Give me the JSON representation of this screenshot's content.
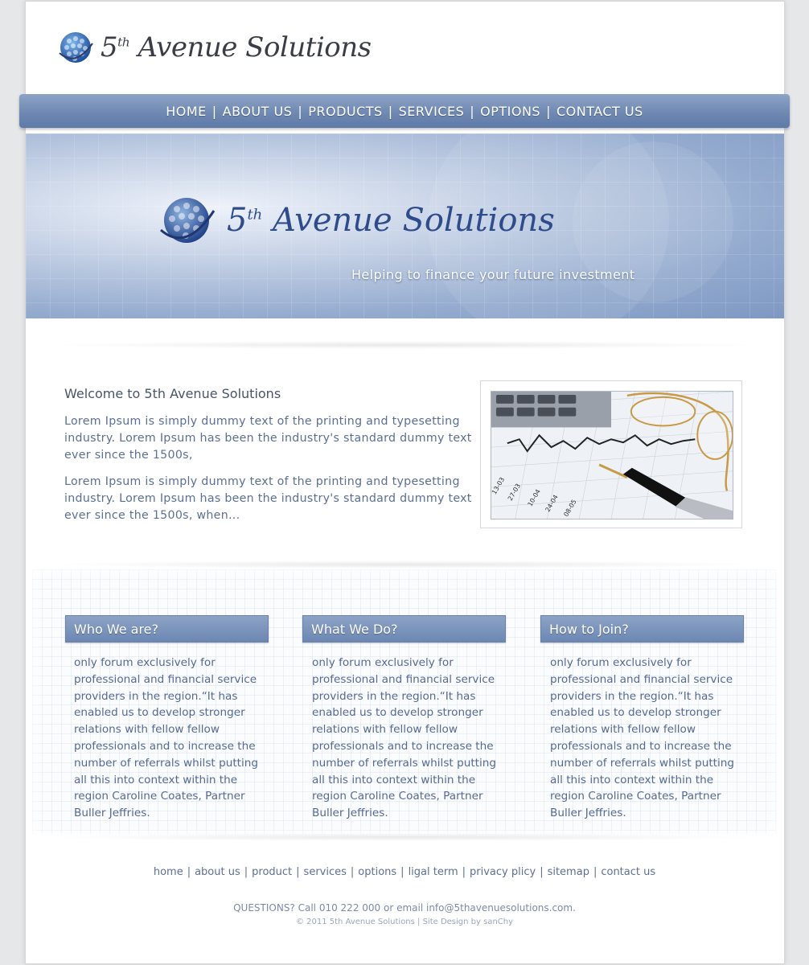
{
  "brand": {
    "name_main": "5",
    "name_sup": "th",
    "name_rest": "Avenue Solutions"
  },
  "nav": {
    "items": [
      {
        "label": "HOME"
      },
      {
        "label": "ABOUT US"
      },
      {
        "label": "PRODUCTS"
      },
      {
        "label": "SERVICES"
      },
      {
        "label": "OPTIONS"
      },
      {
        "label": "CONTACT US"
      }
    ],
    "separator": "|"
  },
  "hero": {
    "tagline": "Helping to finance your future investment"
  },
  "welcome": {
    "title": "Welcome to 5th Avenue Solutions",
    "paragraph1": "Lorem Ipsum is simply dummy text of the printing and typesetting industry. Lorem Ipsum has been the industry's standard dummy text ever since the 1500s,",
    "paragraph2": "Lorem Ipsum is simply dummy text of the printing and typesetting industry. Lorem Ipsum has been the industry's standard dummy text ever since the 1500s, when..."
  },
  "columns": [
    {
      "title": "Who We are?",
      "text": "only forum exclusively for professional and financial service providers in the region.“It has enabled us to develop stronger relations with fellow fellow professionals and to increase the number of referrals whilst putting all this into context within the region Caroline Coates, Partner Buller Jeffries."
    },
    {
      "title": "What We Do?",
      "text": "only forum exclusively for professional and financial service providers in the region.“It has enabled us to develop stronger relations with fellow fellow professionals and to increase the number of referrals whilst putting all this into context within the region Caroline Coates, Partner Buller Jeffries."
    },
    {
      "title": "How to Join?",
      "text": "only forum exclusively for professional and financial service providers in the region.“It has enabled us to develop stronger relations with fellow fellow professionals and to increase the number of referrals whilst putting all this into context within the region Caroline Coates, Partner Buller Jeffries."
    }
  ],
  "footer": {
    "links": [
      {
        "label": "home"
      },
      {
        "label": "about us"
      },
      {
        "label": "product"
      },
      {
        "label": "services"
      },
      {
        "label": "options"
      },
      {
        "label": "ligal term"
      },
      {
        "label": "privacy plicy"
      },
      {
        "label": "sitemap"
      },
      {
        "label": "contact us"
      }
    ],
    "separator": "|",
    "questions": "QUESTIONS? Call 010 222 000 or email info@5thavenuesolutions.com.",
    "copyright": "© 2011 5th Avenue Solutions | Site Design by sanChy"
  },
  "colors": {
    "nav_bg": "#6f89b3",
    "heading_text": "#49546b",
    "body_text": "#5b6f93",
    "brand_blue": "#2e4c8c"
  },
  "icons": [
    "globe-logo-icon"
  ]
}
